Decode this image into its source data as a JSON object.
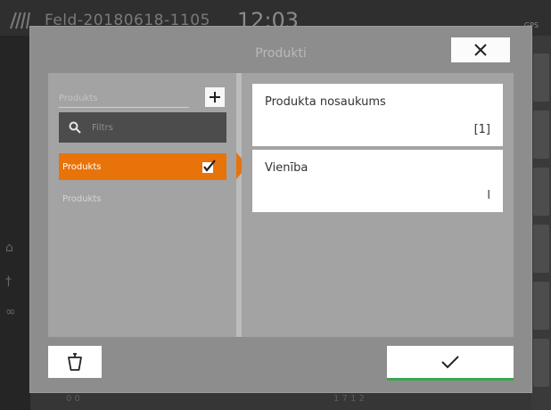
{
  "statusbar": {
    "field_name": "Feld-20180618-1105",
    "time": "12:03",
    "gps_label": "GPS",
    "bottom_text_1": "0 0",
    "bottom_text_2": "1 7 1 2"
  },
  "dialog": {
    "title": "Produkti",
    "close_icon": "close-icon",
    "left_panel": {
      "name_field_text": "Produkts",
      "add_icon": "plus-icon",
      "filter": {
        "placeholder": "Filtrs",
        "value": "",
        "icon": "search-icon"
      },
      "items": [
        {
          "label": "Produkts",
          "selected": true,
          "checked": true
        },
        {
          "label": "Produkts",
          "selected": false,
          "checked": false
        }
      ]
    },
    "right_panel": {
      "attributes": [
        {
          "label": "Produkta nosaukums",
          "value": "[1]"
        },
        {
          "label": "Vienība",
          "value": "l"
        }
      ]
    },
    "footer": {
      "delete_icon": "trash-icon",
      "confirm_icon": "checkmark-icon"
    }
  },
  "colors": {
    "accent": "#e8730a",
    "confirm_underline": "#3aa650",
    "dialog_bg": "#8d8d8d",
    "panel_bg": "#a3a3a3"
  }
}
